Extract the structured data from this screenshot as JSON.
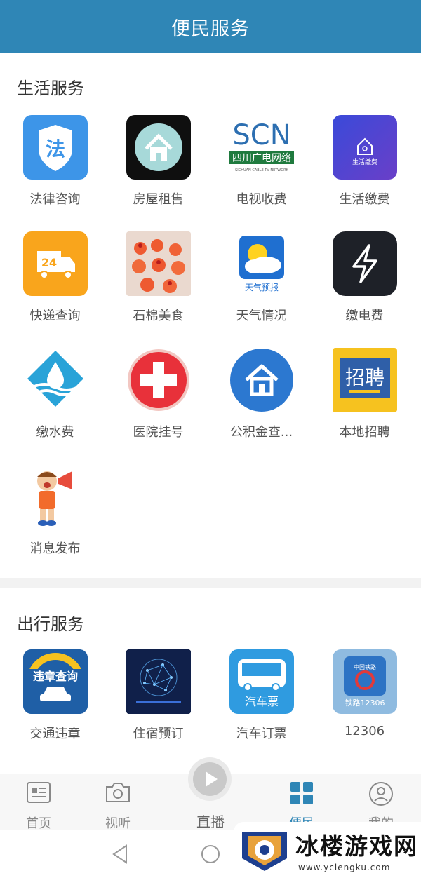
{
  "header": {
    "title": "便民服务"
  },
  "life": {
    "title": "生活服务",
    "items": [
      {
        "label": "法律咨询",
        "icon": "law-icon"
      },
      {
        "label": "房屋租售",
        "icon": "house-rent-icon"
      },
      {
        "label": "电视收费",
        "icon": "scn-tv-icon",
        "logo_main": "SCN",
        "logo_sub": "四川广电网络",
        "logo_en": "SICHUAN CABLE TV NETWORK"
      },
      {
        "label": "生活缴费",
        "icon": "life-payment-icon",
        "icon_text": "生活缴费"
      },
      {
        "label": "快递查询",
        "icon": "delivery-truck-icon",
        "icon_text": "24"
      },
      {
        "label": "石棉美食",
        "icon": "food-photo-icon"
      },
      {
        "label": "天气情况",
        "icon": "weather-icon",
        "icon_text": "天气预报"
      },
      {
        "label": "缴电费",
        "icon": "lightning-icon"
      },
      {
        "label": "缴水费",
        "icon": "water-drop-icon"
      },
      {
        "label": "医院挂号",
        "icon": "hospital-cross-icon"
      },
      {
        "label": "公积金查...",
        "icon": "housing-fund-icon"
      },
      {
        "label": "本地招聘",
        "icon": "recruitment-icon",
        "icon_text": "招聘"
      },
      {
        "label": "消息发布",
        "icon": "megaphone-boy-icon"
      }
    ]
  },
  "travel": {
    "title": "出行服务",
    "items": [
      {
        "label": "交通违章",
        "icon": "traffic-violation-icon",
        "icon_text": "违章查询"
      },
      {
        "label": "住宿预订",
        "icon": "hotel-network-icon"
      },
      {
        "label": "汽车订票",
        "icon": "bus-ticket-icon",
        "icon_text": "汽车票"
      },
      {
        "label": "12306",
        "icon": "railway-icon",
        "icon_text": "铁路12306",
        "icon_top": "中国铁路"
      }
    ]
  },
  "nav": {
    "items": [
      {
        "label": "首页",
        "icon": "home-news-icon"
      },
      {
        "label": "视听",
        "icon": "camera-icon"
      },
      {
        "label": "直播",
        "icon": "play-icon"
      },
      {
        "label": "便民",
        "icon": "grid-icon"
      },
      {
        "label": "我的",
        "icon": "profile-icon"
      }
    ],
    "active": "便民"
  },
  "watermark": {
    "text": "冰楼游戏网",
    "url": "www.yclengku.com"
  },
  "colors": {
    "header": "#2f86b6",
    "active": "#2f86b6"
  }
}
